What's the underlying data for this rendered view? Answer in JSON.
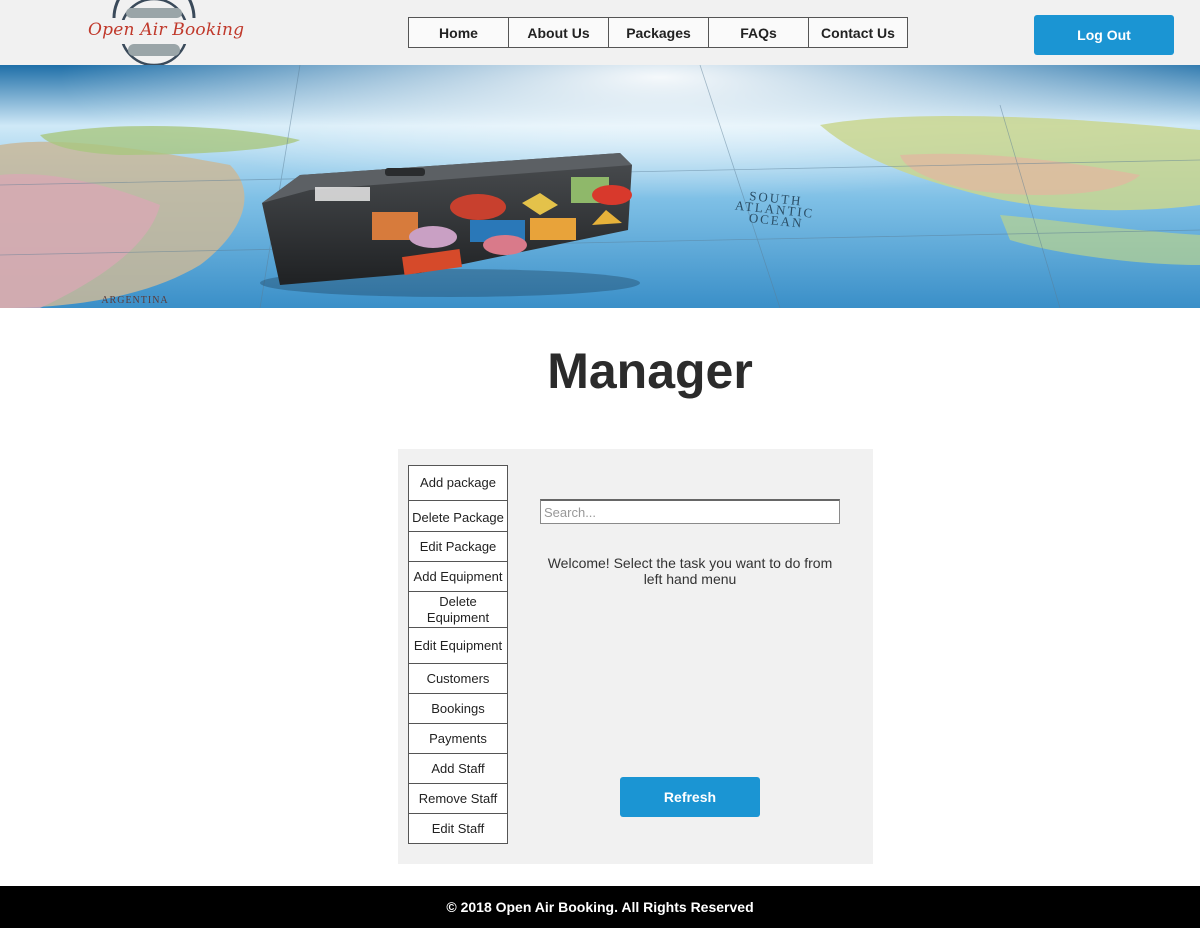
{
  "brand": {
    "name": "Open Air Booking"
  },
  "nav": {
    "items": [
      {
        "label": "Home"
      },
      {
        "label": "About Us"
      },
      {
        "label": "Packages"
      },
      {
        "label": "FAQs"
      },
      {
        "label": "Contact Us"
      }
    ]
  },
  "header": {
    "logout_label": "Log Out"
  },
  "banner": {
    "map_labels": {
      "ocean": "SOUTH ATLANTIC OCEAN",
      "country": "ARGENTINA"
    }
  },
  "main": {
    "title": "Manager",
    "menu": [
      {
        "label": "Add package"
      },
      {
        "label": "Delete Package"
      },
      {
        "label": "Edit Package"
      },
      {
        "label": "Add Equipment"
      },
      {
        "label": "Delete Equipment"
      },
      {
        "label": "Edit Equipment"
      },
      {
        "label": "Customers"
      },
      {
        "label": "Bookings"
      },
      {
        "label": "Payments"
      },
      {
        "label": "Add Staff"
      },
      {
        "label": "Remove Staff"
      },
      {
        "label": "Edit Staff"
      }
    ],
    "search": {
      "placeholder": "Search..."
    },
    "welcome_text": "Welcome! Select the task you want to do from left hand menu",
    "refresh_label": "Refresh"
  },
  "footer": {
    "copyright": "© 2018 Open Air Booking. All Rights Reserved"
  },
  "colors": {
    "accent": "#1b95d3",
    "header_bg": "#f1f1f1",
    "footer_bg": "#000000",
    "logo_text": "#c0392b"
  }
}
